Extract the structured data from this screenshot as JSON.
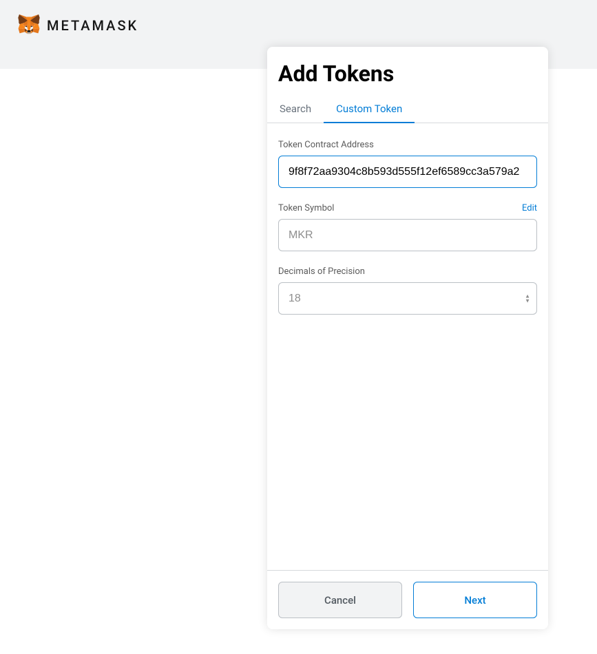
{
  "brand": {
    "name": "METAMASK"
  },
  "modal": {
    "title": "Add Tokens",
    "tabs": {
      "search": "Search",
      "custom": "Custom Token"
    },
    "fields": {
      "contract_address": {
        "label": "Token Contract Address",
        "value": "9f8f72aa9304c8b593d555f12ef6589cc3a579a2"
      },
      "symbol": {
        "label": "Token Symbol",
        "edit": "Edit",
        "value": "MKR"
      },
      "decimals": {
        "label": "Decimals of Precision",
        "value": "18"
      }
    },
    "buttons": {
      "cancel": "Cancel",
      "next": "Next"
    }
  }
}
